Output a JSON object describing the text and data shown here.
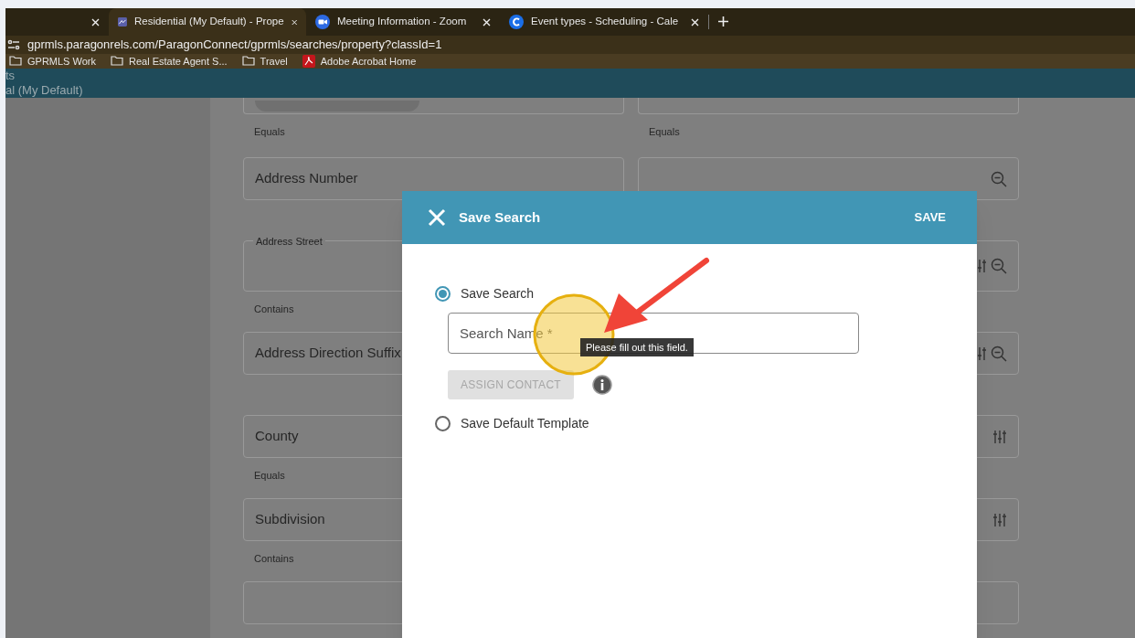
{
  "browser": {
    "tabs": [
      {
        "kind": "blank",
        "selected": false
      },
      {
        "title": "Residential (My Default) - Prope",
        "kind": "paragon",
        "selected": true
      },
      {
        "title": "Meeting Information - Zoom",
        "kind": "zoom",
        "selected": false
      },
      {
        "title": "Event types - Scheduling - Cale",
        "kind": "calendar",
        "selected": false
      }
    ],
    "address": "gprmls.paragonrels.com/ParagonConnect/gprmls/searches/property?classId=1",
    "bookmarks": [
      {
        "label": "GPRMLS Work",
        "kind": "folder"
      },
      {
        "label": "Real Estate Agent S...",
        "kind": "folder"
      },
      {
        "label": "Travel",
        "kind": "folder"
      },
      {
        "label": "Adobe Acrobat Home",
        "kind": "pdf"
      }
    ]
  },
  "app_header": {
    "title": "ts",
    "subtitle": "al (My Default)"
  },
  "form_rows": [
    {
      "kind": "cut",
      "left": {
        "sublabel": "Equals"
      },
      "right": {
        "sublabel": "Equals",
        "kind": "plain"
      }
    },
    {
      "kind": "field",
      "left": {
        "label": "Address Number"
      },
      "right": {
        "kind": "zoom"
      }
    },
    {
      "kind": "legend",
      "left": {
        "label": "Address Street",
        "sublabel": "Contains"
      },
      "right": {
        "kind": "sliders_zoom"
      }
    },
    {
      "kind": "field",
      "left": {
        "label": "Address Direction Suffix"
      },
      "right": {
        "kind": "sliders_zoom"
      }
    },
    {
      "kind": "field",
      "left": {
        "label": "County",
        "sublabel": "Equals"
      },
      "right": {
        "kind": "sliders"
      }
    },
    {
      "kind": "field",
      "left": {
        "label": "Subdivision",
        "sublabel": "Contains"
      },
      "right": {
        "kind": "sliders"
      }
    },
    {
      "kind": "field",
      "left": {},
      "right": {
        "kind": "plain"
      }
    }
  ],
  "dialog": {
    "title": "Save Search",
    "save_button": "SAVE",
    "options": [
      {
        "label": "Save Search",
        "selected": true
      },
      {
        "label": "Save Default Template",
        "selected": false
      }
    ],
    "search_name": {
      "placeholder": "Search Name *"
    },
    "assign_button": {
      "label": "ASSIGN CONTACT",
      "disabled": true
    },
    "tooltip": "Please fill out this field."
  }
}
